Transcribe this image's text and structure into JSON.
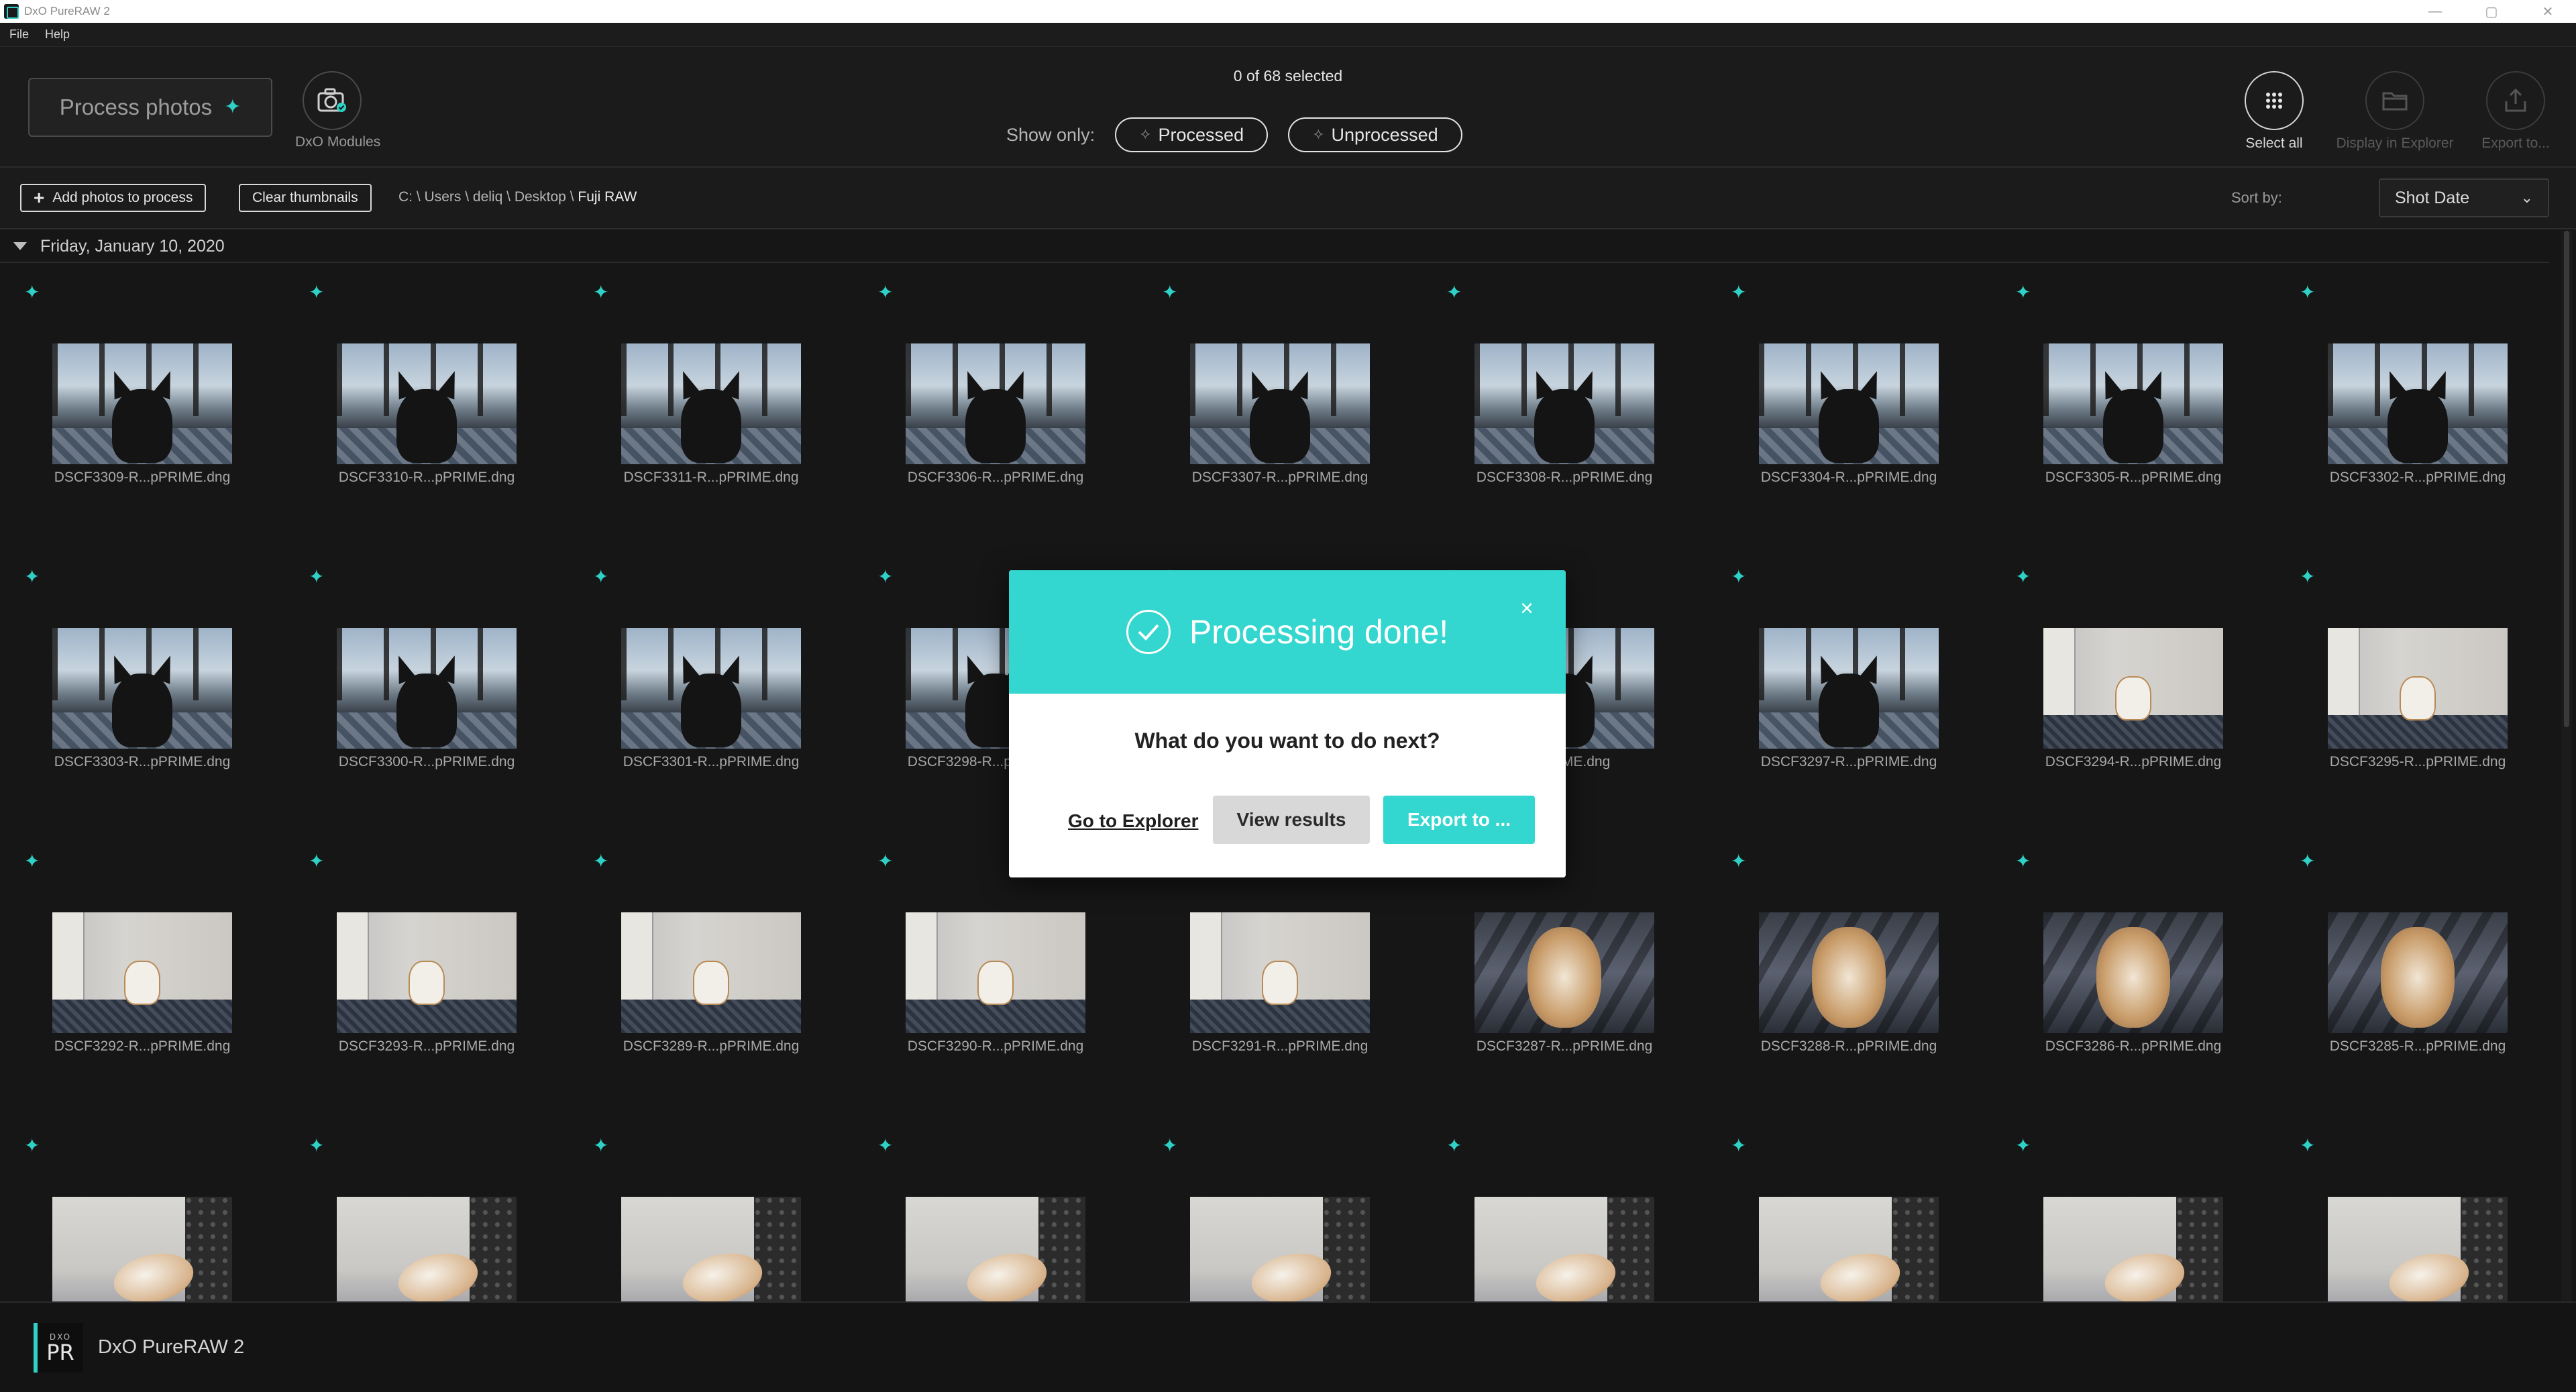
{
  "window": {
    "title": "DxO PureRAW 2",
    "controls": [
      "—",
      "▢",
      "✕"
    ]
  },
  "menu": {
    "items": [
      "File",
      "Help"
    ]
  },
  "toolbar": {
    "process_label": "Process photos",
    "modules_label": "DxO Modules",
    "selected_text": "0 of 68 selected",
    "show_only_label": "Show only:",
    "filter_processed": "Processed",
    "filter_unprocessed": "Unprocessed",
    "select_all": "Select all",
    "display_in_explorer": "Display in Explorer",
    "export_to": "Export to..."
  },
  "subbar": {
    "add_photos": "Add photos to process",
    "clear_thumbnails": "Clear thumbnails",
    "path": [
      "C:",
      "Users",
      "deliq",
      "Desktop",
      "Fuji RAW"
    ],
    "path_sep": "\\",
    "sort_label": "Sort by:",
    "sort_value": "Shot Date"
  },
  "group": {
    "date": "Friday, January 10, 2020"
  },
  "photos": [
    {
      "name": "DSCF3309-R...pPRIME.dng",
      "scene": "A"
    },
    {
      "name": "DSCF3310-R...pPRIME.dng",
      "scene": "A"
    },
    {
      "name": "DSCF3311-R...pPRIME.dng",
      "scene": "A"
    },
    {
      "name": "DSCF3306-R...pPRIME.dng",
      "scene": "A"
    },
    {
      "name": "DSCF3307-R...pPRIME.dng",
      "scene": "A"
    },
    {
      "name": "DSCF3308-R...pPRIME.dng",
      "scene": "A"
    },
    {
      "name": "DSCF3304-R...pPRIME.dng",
      "scene": "A"
    },
    {
      "name": "DSCF3305-R...pPRIME.dng",
      "scene": "A"
    },
    {
      "name": "DSCF3302-R...pPRIME.dng",
      "scene": "A"
    },
    {
      "name": "DSCF3303-R...pPRIME.dng",
      "scene": "A"
    },
    {
      "name": "DSCF3300-R...pPRIME.dng",
      "scene": "A"
    },
    {
      "name": "DSCF3301-R...pPRIME.dng",
      "scene": "A"
    },
    {
      "name": "DSCF3298-R...pPRIME.dng",
      "scene": "A"
    },
    {
      "name": "",
      "scene": "A"
    },
    {
      "name": "...pPRIME.dng",
      "scene": "A"
    },
    {
      "name": "DSCF3297-R...pPRIME.dng",
      "scene": "A"
    },
    {
      "name": "DSCF3294-R...pPRIME.dng",
      "scene": "B"
    },
    {
      "name": "DSCF3295-R...pPRIME.dng",
      "scene": "B"
    },
    {
      "name": "DSCF3292-R...pPRIME.dng",
      "scene": "B"
    },
    {
      "name": "DSCF3293-R...pPRIME.dng",
      "scene": "B"
    },
    {
      "name": "DSCF3289-R...pPRIME.dng",
      "scene": "B"
    },
    {
      "name": "DSCF3290-R...pPRIME.dng",
      "scene": "B"
    },
    {
      "name": "DSCF3291-R...pPRIME.dng",
      "scene": "B"
    },
    {
      "name": "DSCF3287-R...pPRIME.dng",
      "scene": "C"
    },
    {
      "name": "DSCF3288-R...pPRIME.dng",
      "scene": "C"
    },
    {
      "name": "DSCF3286-R...pPRIME.dng",
      "scene": "C"
    },
    {
      "name": "DSCF3285-R...pPRIME.dng",
      "scene": "C"
    },
    {
      "name": "",
      "scene": "D"
    },
    {
      "name": "",
      "scene": "D"
    },
    {
      "name": "",
      "scene": "D"
    },
    {
      "name": "",
      "scene": "D"
    },
    {
      "name": "",
      "scene": "D"
    },
    {
      "name": "",
      "scene": "D"
    },
    {
      "name": "",
      "scene": "D"
    },
    {
      "name": "",
      "scene": "D"
    },
    {
      "name": "",
      "scene": "D"
    }
  ],
  "dialog": {
    "title": "Processing done!",
    "question": "What do you want to do next?",
    "go_to_explorer": "Go to Explorer",
    "view_results": "View results",
    "export_to": "Export to ...",
    "close_glyph": "×"
  },
  "footer": {
    "logo_top": "DXO",
    "logo_pr": "PR",
    "app_name": "DxO PureRAW 2"
  },
  "colors": {
    "accent": "#34d6d0",
    "background": "#161616",
    "panel": "#1b1b1b"
  }
}
